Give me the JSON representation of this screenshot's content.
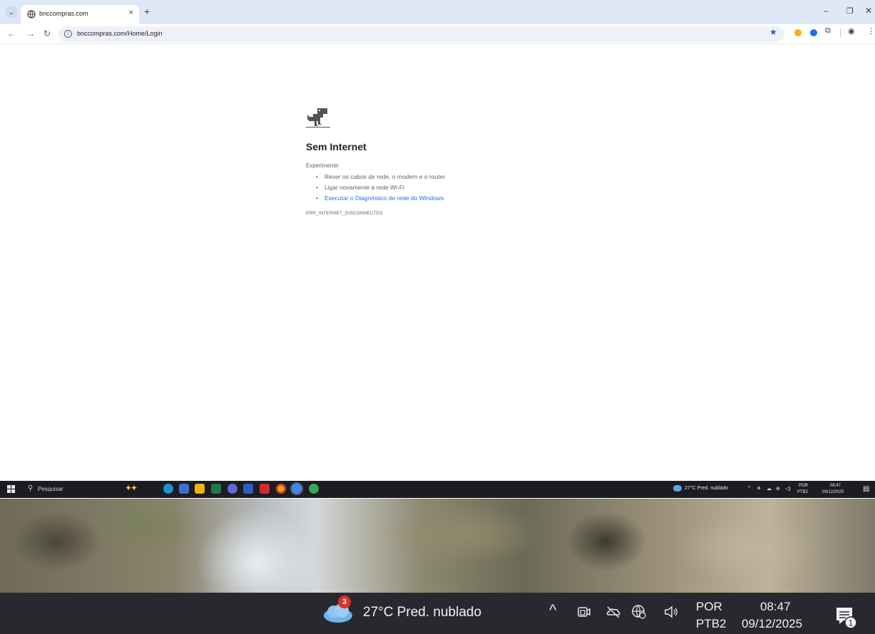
{
  "browser": {
    "tab_title": "bnccompras.com",
    "tab_close": "×",
    "new_tab": "+",
    "url": "bnccompras.com/Home/Login",
    "window_min": "–",
    "window_max": "❐",
    "window_close": "✕"
  },
  "error": {
    "title": "Sem Internet",
    "try_label": "Experimente:",
    "suggestions": [
      "Rever os cabos de rede, o modem e o router",
      "Ligar novamente à rede Wi-Fi",
      "Executar o Diagnóstico de rede do Windows"
    ],
    "code": "ERR_INTERNET_DISCONNECTED"
  },
  "taskbar_small": {
    "search_placeholder": "Pesquisar",
    "weather": "27°C  Pred. nublado",
    "lang1": "POR",
    "lang2": "PTB2",
    "time": "08:47",
    "date": "09/12/2025"
  },
  "taskbar_big": {
    "weather_badge": "3",
    "weather": "27°C  Pred. nublado",
    "lang1": "POR",
    "lang2": "PTB2",
    "time": "08:47",
    "date": "09/12/2025",
    "notification_count": "1"
  },
  "colors": {
    "accent": "#1a73e8",
    "tabstrip": "#dee8f7",
    "taskbar": "#28292e"
  }
}
